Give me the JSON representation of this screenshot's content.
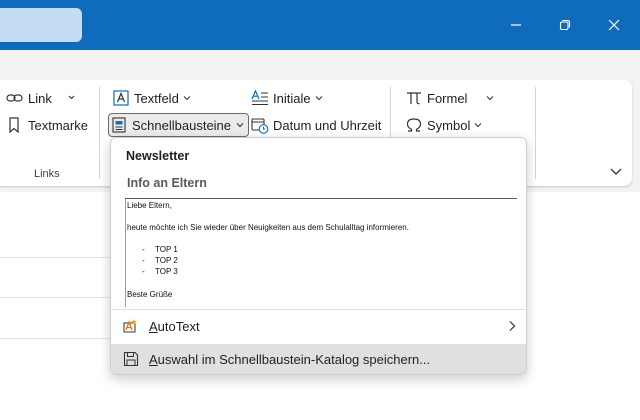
{
  "ribbon": {
    "links_group": {
      "link_label": "Link",
      "textmarke_label": "Textmarke",
      "group_label": "Links"
    },
    "text_group": {
      "textfeld_label": "Textfeld",
      "schnellbausteine_label": "Schnellbausteine",
      "initiale_label": "Initiale",
      "datum_label": "Datum und Uhrzeit"
    },
    "symbols_group": {
      "formel_label": "Formel",
      "symbol_label": "Symbol"
    }
  },
  "dropdown": {
    "section_title": "Newsletter",
    "entry_title": "Info an Eltern",
    "preview": {
      "greeting": "Liebe Eltern,",
      "body": "heute möchte ich Sie wieder über Neuigkeiten aus dem Schulalltag informieren.",
      "bullets": [
        "TOP 1",
        "TOP 2",
        "TOP 3"
      ],
      "bullet_marker": "-",
      "closing": "Beste Grüße"
    },
    "items": [
      {
        "label": "AutoText",
        "mnemonic": "A",
        "rest": "utoText",
        "has_submenu": true,
        "icon": "autotext-icon"
      },
      {
        "label": "Auswahl im Schnellbaustein-Katalog speichern...",
        "mnemonic": "A",
        "rest": "uswahl im Schnellbaustein-Katalog speichern...",
        "has_submenu": false,
        "icon": "save-icon"
      }
    ]
  },
  "colors": {
    "titlebar": "#0f6cbd",
    "search_box": "#c4ddf3",
    "ribbon_bg": "#f3f3f3",
    "hover": "#e0e0e0"
  }
}
